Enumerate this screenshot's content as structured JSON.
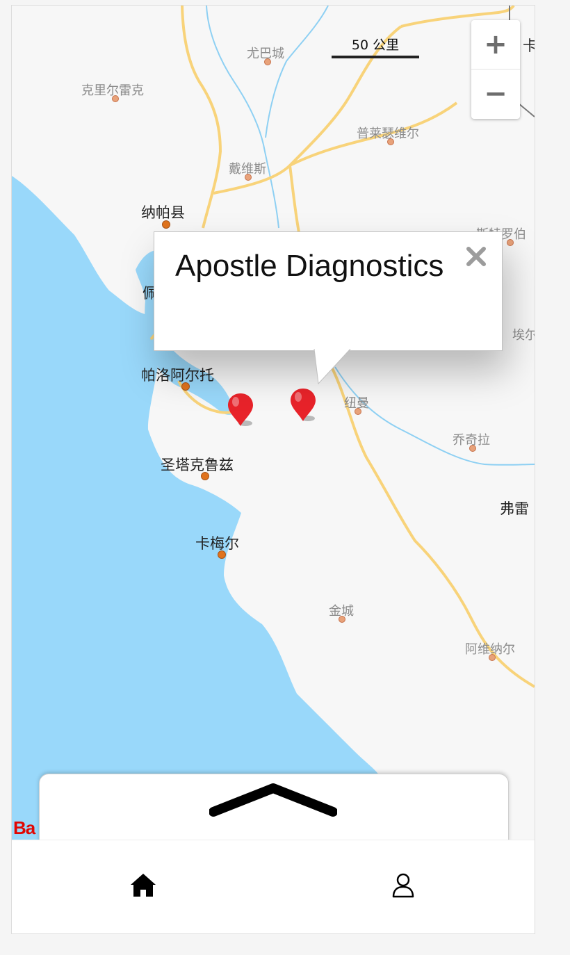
{
  "map": {
    "places": [
      {
        "id": "yubacheng",
        "name": "尤巴城",
        "major": false
      },
      {
        "id": "kelierleike",
        "name": "克里尔雷克",
        "major": false
      },
      {
        "id": "pulaisewei",
        "name": "普莱瑟维尔",
        "major": false
      },
      {
        "id": "daiweisi",
        "name": "戴维斯",
        "major": false
      },
      {
        "id": "napa",
        "name": "纳帕县",
        "major": true
      },
      {
        "id": "siteluobo",
        "name": "斯特罗伯",
        "major": false
      },
      {
        "id": "aier",
        "name": "埃尔",
        "major": false
      },
      {
        "id": "paluoaerto",
        "name": "帕洛阿尔托",
        "major": true
      },
      {
        "id": "niuman",
        "name": "纽曼",
        "major": false
      },
      {
        "id": "qiaoqila",
        "name": "乔奇拉",
        "major": false
      },
      {
        "id": "shengtakelu",
        "name": "圣塔克鲁兹",
        "major": true
      },
      {
        "id": "fulei",
        "name": "弗雷",
        "major": true
      },
      {
        "id": "kameier",
        "name": "卡梅尔",
        "major": true
      },
      {
        "id": "jincheng",
        "name": "金城",
        "major": false
      },
      {
        "id": "aweinaer",
        "name": "阿维纳尔",
        "major": false
      },
      {
        "id": "ka",
        "name": "卡",
        "major": true
      },
      {
        "id": "pei",
        "name": "佩",
        "major": true
      }
    ],
    "scale_label": "50 公里",
    "zoom_in_symbol": "+",
    "zoom_out_symbol": "−",
    "logo_text": "Ba",
    "colors": {
      "water": "#99d8fa",
      "land": "#f7f7f7",
      "road": "#f8d37a",
      "river": "#8ed0f3",
      "marker": "#e8232a"
    }
  },
  "popup": {
    "title": "Apostle Diagnostics",
    "close_icon": "close-icon"
  },
  "markers": [
    {
      "id": "marker-1",
      "icon": "map-pin-icon"
    },
    {
      "id": "marker-2",
      "icon": "map-pin-icon"
    }
  ],
  "drawer": {
    "handle_icon": "chevron-up-icon"
  },
  "tabbar": {
    "tabs": [
      {
        "id": "home",
        "icon": "home-icon"
      },
      {
        "id": "profile",
        "icon": "user-icon"
      }
    ]
  }
}
